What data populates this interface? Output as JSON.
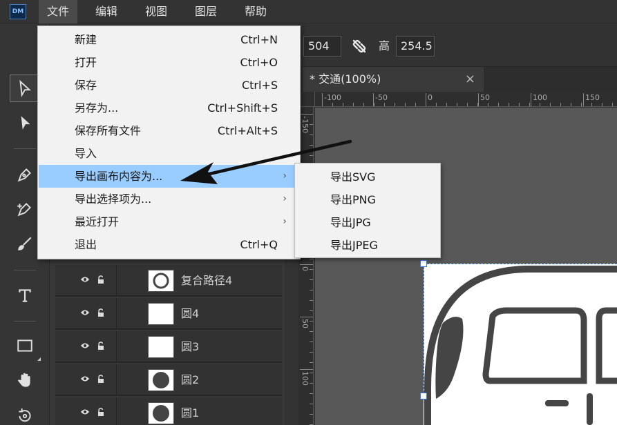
{
  "app": {
    "logo_text": "DM"
  },
  "menubar": {
    "items": [
      "文件",
      "编辑",
      "视图",
      "图层",
      "帮助"
    ]
  },
  "options_bar": {
    "width_value": "504",
    "height_label": "高",
    "height_value": "254.5"
  },
  "document": {
    "tab_title": "* 交通(100%)",
    "close_glyph": "×"
  },
  "ruler": {
    "h_labels": [
      "-100",
      "-50",
      "0",
      "50",
      "100",
      "150"
    ],
    "v_labels": [
      "-150",
      "0",
      "50",
      "100"
    ]
  },
  "layers": [
    {
      "name": "复合路径4",
      "thumb": "ring"
    },
    {
      "name": "圆4",
      "thumb": "blank"
    },
    {
      "name": "圆3",
      "thumb": "blank"
    },
    {
      "name": "圆2",
      "thumb": "disc"
    },
    {
      "name": "圆1",
      "thumb": "disc"
    }
  ],
  "file_menu": {
    "items": [
      {
        "label": "新建",
        "shortcut": "Ctrl+N"
      },
      {
        "label": "打开",
        "shortcut": "Ctrl+O"
      },
      {
        "label": "保存",
        "shortcut": "Ctrl+S"
      },
      {
        "label": "另存为...",
        "shortcut": "Ctrl+Shift+S"
      },
      {
        "label": "保存所有文件",
        "shortcut": "Ctrl+Alt+S"
      },
      {
        "label": "导入",
        "shortcut": ""
      },
      {
        "label": "导出画布内容为...",
        "shortcut": "",
        "submenu": true,
        "highlighted": true
      },
      {
        "label": "导出选择项为...",
        "shortcut": "",
        "submenu": true
      },
      {
        "label": "最近打开",
        "shortcut": "",
        "submenu": true
      },
      {
        "label": "退出",
        "shortcut": "Ctrl+Q"
      }
    ],
    "arrow_glyph": "›"
  },
  "export_submenu": {
    "items": [
      "导出SVG",
      "导出PNG",
      "导出JPG",
      "导出JPEG"
    ]
  },
  "colors": {
    "highlight": "#99ccff",
    "selection": "#3b7bd6",
    "panel": "#333333",
    "canvas": "#585858"
  }
}
